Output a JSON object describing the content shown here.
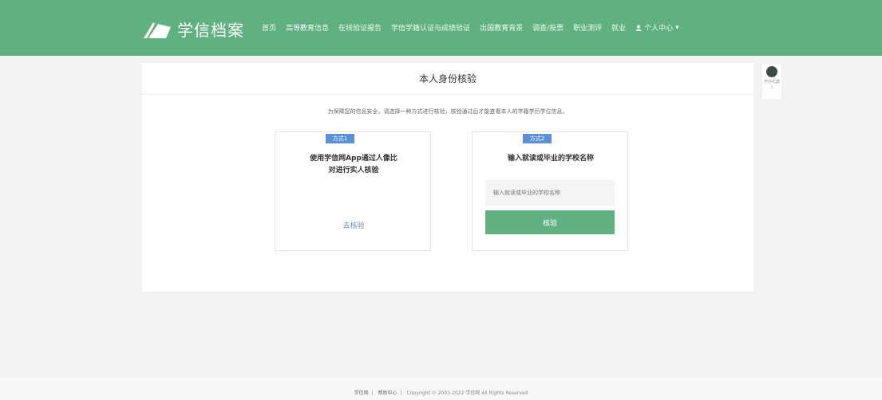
{
  "header": {
    "logo_text": "学信档案",
    "nav": [
      "首页",
      "高等教育信息",
      "在线验证报告",
      "学信学籍认证与成绩验证",
      "出国教育背景",
      "调查/投票",
      "职业测评",
      "就业",
      "个人中心"
    ]
  },
  "side_widget": {
    "label": "学信机器人"
  },
  "panel": {
    "title": "本人身份核验",
    "intro": "为保障您的信息安全，请选择一种方式进行核验，核验通过后才能查看本人的学籍学历学位信息。",
    "method1": {
      "badge": "方式1",
      "title": "使用学信网App通过人像比对进行实人核验",
      "link": "去核验"
    },
    "method2": {
      "badge": "方式2",
      "title": "输入就读或毕业的学校名称",
      "input_placeholder": "输入就读或毕业的学校名称",
      "button": "核验"
    }
  },
  "footer": {
    "link1": "学信网",
    "link2": "帮助中心",
    "copyright": "Copyright © 2003-2022 学信网 All Rights Reserved"
  }
}
